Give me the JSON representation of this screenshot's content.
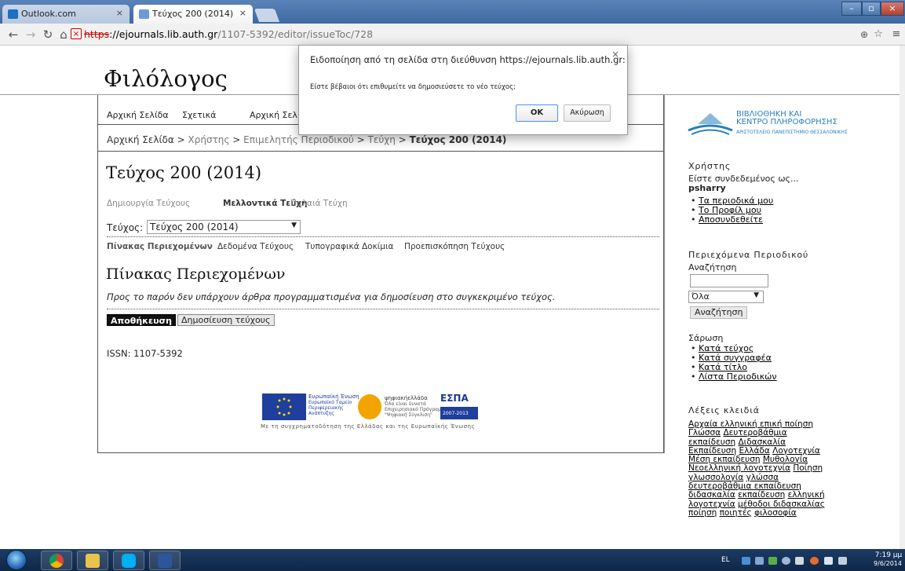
{
  "browser": {
    "tabs": [
      {
        "title": "Outlook.com",
        "active": false
      },
      {
        "title": "Τεύχος 200 (2014)",
        "active": true
      }
    ],
    "url": {
      "scheme": "https",
      "host": "://ejournals.lib.auth.gr",
      "path": "/1107-5392/editor/issueToc/728"
    }
  },
  "site": {
    "title": "Φιλόλογος"
  },
  "nav": {
    "items": [
      "Αρχική Σελίδα",
      "Σχετικά",
      "Αρχική Σελ"
    ]
  },
  "breadcrumb": {
    "home": "Αρχική Σελίδα",
    "sep": ">",
    "user": "Χρήστης",
    "editor": "Επιμελητής Περιοδικού",
    "issues": "Τεύχη",
    "current": "Τεύχος 200 (2014)"
  },
  "issue": {
    "title": "Τεύχος 200 (2014)",
    "subnav": [
      "Δημιουργία Τεύχους",
      "Μελλοντικά Τεύχη",
      "Παλαιά Τεύχη"
    ],
    "select_label": "Τεύχος:",
    "select_value": "Τεύχος 200 (2014)",
    "tabs": [
      "Πίνακας Περιεχομένων",
      "Δεδομένα Τεύχους",
      "Τυπογραφικά Δοκίμια",
      "Προεπισκόπηση Τεύχους"
    ],
    "toc_heading": "Πίνακας Περιεχομένων",
    "toc_empty": "Προς το παρόν δεν υπάρχουν άρθρα προγραμματισμένα για δημοσίευση στο συγκεκριμένο τεύχος.",
    "save_label": "Αποθήκευση",
    "publish_label": "Δημοσίευση τεύχους",
    "issn": "ISSN: 1107-5392"
  },
  "footer": {
    "eu_text": [
      "Ευρωπαϊκή Ένωση",
      "Ευρωπαϊκό Ταμείο",
      "Περιφερειακής",
      "Ανάπτυξης"
    ],
    "digital_text": [
      "ψηφιακήελλάδα",
      "Όλα είναι δυνατά",
      "Επιχειρησιακό Πρόγραμμα",
      "\"Ψηφιακή Σύγκλιση\""
    ],
    "espa": "ΕΣΠΑ",
    "espa_years": "2007-2013",
    "caption": "Με τη συγχρηματοδότηση της Ελλάδας και της Ευρωπαϊκής Ένωσης"
  },
  "sidebar": {
    "library_logo": [
      "ΒΙΒΛΙΟΘΗΚΗ ΚΑΙ",
      "ΚΕΝΤΡΟ ΠΛΗΡΟΦΟΡΗΣΗΣ"
    ],
    "library_sub": "ΑΡΙΣΤΟΤΕΛΕΙΟ ΠΑΝΕΠΙΣΤΗΜΙΟ ΘΕΣΣΑΛΟΝΙΚΗΣ",
    "user_heading": "Χρήστης",
    "logged_in_as": "Είστε συνδεδεμένος ως...",
    "username": "psharry",
    "user_links": [
      "Τα περιοδικά μου",
      "Το Προφίλ μου",
      "Αποσυνδεθείτε"
    ],
    "content_heading": "Περιεχόμενα Περιοδικού",
    "search_label": "Αναζήτηση",
    "search_scope": "Όλα",
    "search_button": "Αναζήτηση",
    "browse_heading": "Σάρωση",
    "browse_links": [
      "Κατά τεύχος",
      "Κατά συγγραφέα",
      "Κατά τίτλο",
      "Λίστα Περιοδικών"
    ],
    "keywords_heading": "Λέξεις κλειδιά",
    "keywords": [
      "Αρχαία ελληνική επική ποίηση",
      "Γλώσσα",
      "Δευτεροβάθμια εκπαίδευση",
      "Διδασκαλία",
      "Εκπαίδευση",
      "Ελλάδα",
      "Λογοτεχνία",
      "Μέση εκπαίδευση",
      "Μυθολογία",
      "Νεοελληνική λογοτεχνία",
      "Ποίηση",
      "γλωσσολογία",
      "γλώσσα",
      "δευτεροβάθμια εκπαίδευση",
      "διδασκαλία",
      "εκπαίδευση",
      "ελληνική λογοτεχνία",
      "μέθοδοι διδασκαλίας",
      "ποίηση",
      "ποιητές",
      "φιλοσοφία"
    ]
  },
  "dialog": {
    "title": "Ειδοποίηση από τη σελίδα στη διεύθυνση https://ejournals.lib.auth.gr:",
    "message": "Είστε βέβαιοι ότι επιθυμείτε να δημοσιεύσετε το νέο τεύχος;",
    "ok_label": "OK",
    "cancel_label": "Ακύρωση",
    "close_glyph": "×"
  },
  "taskbar": {
    "lang": "EL",
    "time": "7:19 μμ",
    "date": "9/6/2014"
  },
  "colors": {
    "accent": "#4d90fe",
    "link": "#000000",
    "library_blue": "#2a7fbd",
    "taskbar": "#1c3b63"
  }
}
